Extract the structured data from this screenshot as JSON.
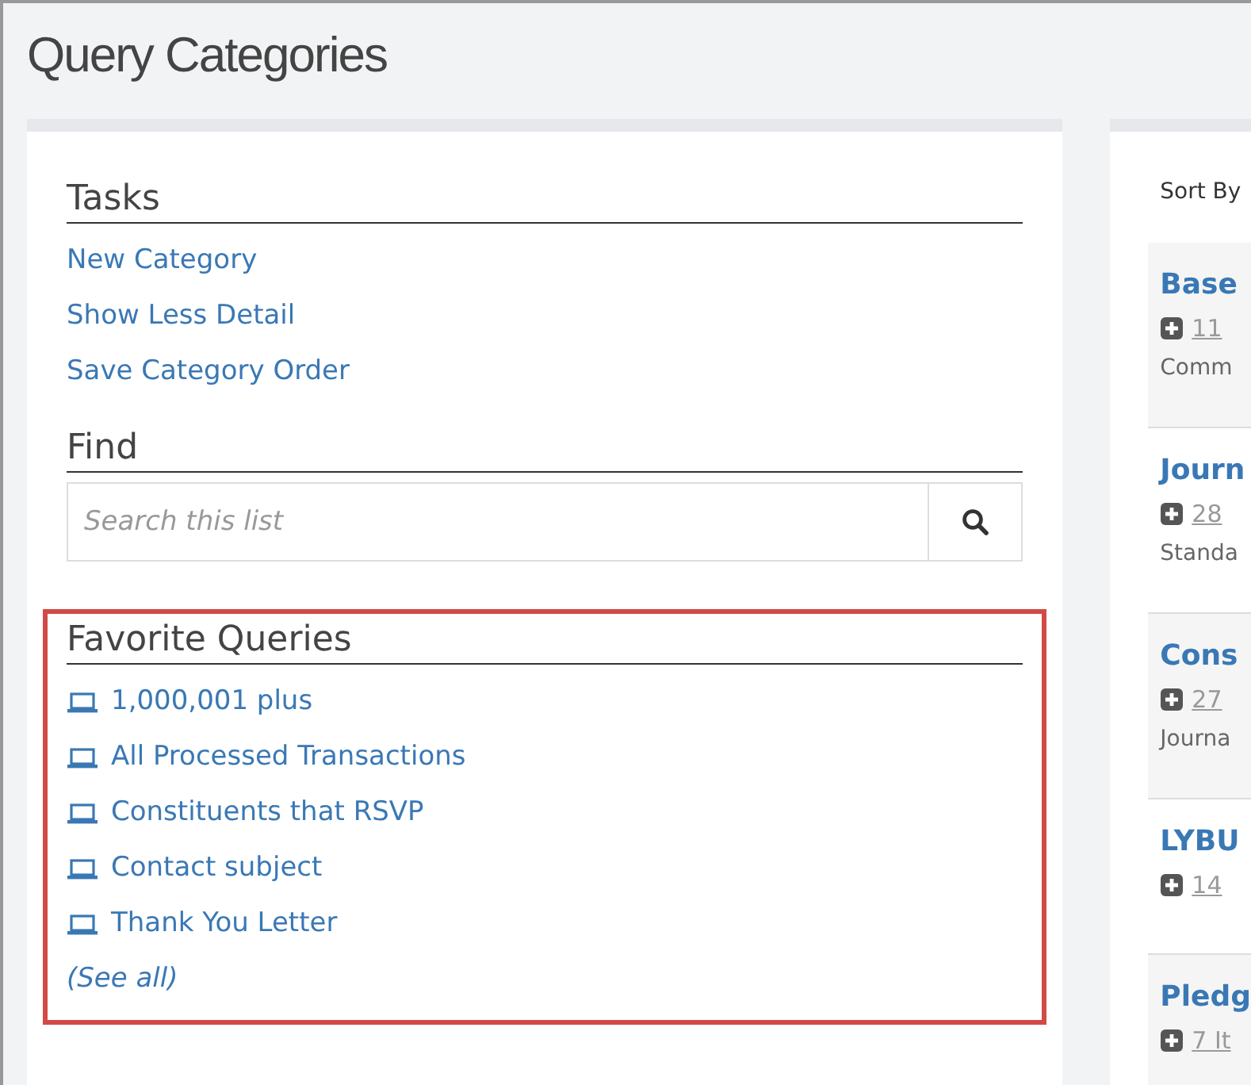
{
  "page_title": "Query Categories",
  "tasks": {
    "heading": "Tasks",
    "links": [
      "New Category",
      "Show Less Detail",
      "Save Category Order"
    ]
  },
  "find": {
    "heading": "Find",
    "search": {
      "placeholder": "Search this list"
    }
  },
  "favorite_queries": {
    "heading": "Favorite Queries",
    "highlighted": true,
    "items": [
      "1,000,001 plus",
      "All Processed Transactions",
      "Constituents that RSVP",
      "Contact subject",
      "Thank You Letter"
    ],
    "see_all": "(See all)"
  },
  "categories": {
    "sort_label": "Sort By",
    "items": [
      {
        "name": "Base",
        "count": "11",
        "description": "Comm"
      },
      {
        "name": "Journ",
        "count": "28",
        "description": "Standa"
      },
      {
        "name": "Cons",
        "count": "27",
        "description": "Journa"
      },
      {
        "name": "LYBU",
        "count": "14"
      },
      {
        "name": "Pledg",
        "count": "7 It"
      }
    ]
  }
}
